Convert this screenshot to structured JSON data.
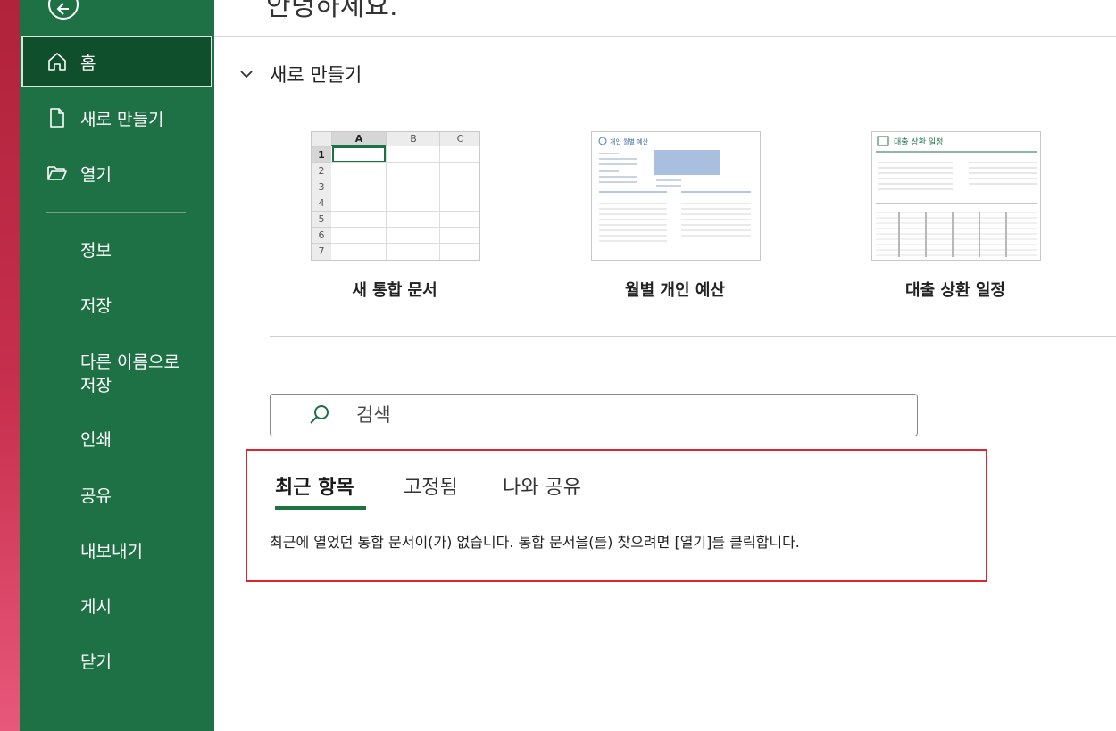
{
  "greeting": "안녕하세요.",
  "sidebar": {
    "back_icon": "back-arrow-icon",
    "primary": [
      {
        "label": "홈",
        "icon": "home-icon",
        "active": true
      },
      {
        "label": "새로 만들기",
        "icon": "new-document-icon"
      },
      {
        "label": "열기",
        "icon": "folder-open-icon"
      }
    ],
    "secondary": [
      {
        "label": "정보"
      },
      {
        "label": "저장"
      },
      {
        "label": "다른 이름으로 저장"
      },
      {
        "label": "인쇄"
      },
      {
        "label": "공유"
      },
      {
        "label": "내보내기"
      },
      {
        "label": "게시"
      },
      {
        "label": "닫기"
      }
    ]
  },
  "new_section": {
    "title": "새로 만들기",
    "templates": [
      {
        "label": "새 통합 문서",
        "columns": [
          "A",
          "B",
          "C"
        ],
        "rows": [
          "1",
          "2",
          "3",
          "4",
          "5",
          "6",
          "7"
        ]
      },
      {
        "label": "월별 개인 예산",
        "title": "개인 월별 예산"
      },
      {
        "label": "대출 상환 일정",
        "title": "대출 상환 일정"
      }
    ]
  },
  "search": {
    "placeholder": "검색"
  },
  "recent": {
    "tabs": [
      "최근 항목",
      "고정됨",
      "나와 공유"
    ],
    "active_tab": 0,
    "empty_message": "최근에 열었던 통합 문서이(가) 없습니다. 통합 문서을(를) 찾으려면 [열기]를 클릭합니다."
  },
  "colors": {
    "sidebar": "#1e7145",
    "active_item": "#0f4f2c",
    "highlight_border": "#e0242e",
    "accent_strip": "#c8304e"
  }
}
